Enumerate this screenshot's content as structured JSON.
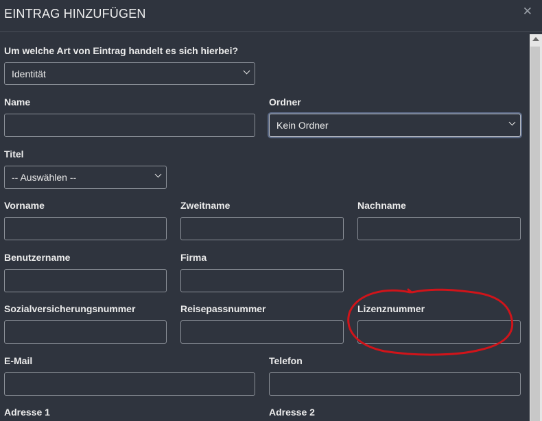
{
  "dialog": {
    "title": "EINTRAG HINZUFÜGEN",
    "close_icon": "close-icon"
  },
  "form": {
    "type_question": "Um welche Art von Eintrag handelt es sich hierbei?",
    "type_selected": "Identität",
    "name_label": "Name",
    "folder_label": "Ordner",
    "folder_selected": "Kein Ordner",
    "title_label": "Titel",
    "title_selected": "-- Auswählen --",
    "first_name_label": "Vorname",
    "middle_name_label": "Zweitname",
    "last_name_label": "Nachname",
    "username_label": "Benutzername",
    "company_label": "Firma",
    "ssn_label": "Sozialversicherungsnummer",
    "passport_label": "Reisepassnummer",
    "license_label": "Lizenznummer",
    "email_label": "E-Mail",
    "phone_label": "Telefon",
    "address1_label": "Adresse 1",
    "address2_label": "Adresse 2"
  },
  "colors": {
    "background": "#2f343e",
    "input_border": "#8c9199",
    "annotation": "#d0141a"
  }
}
